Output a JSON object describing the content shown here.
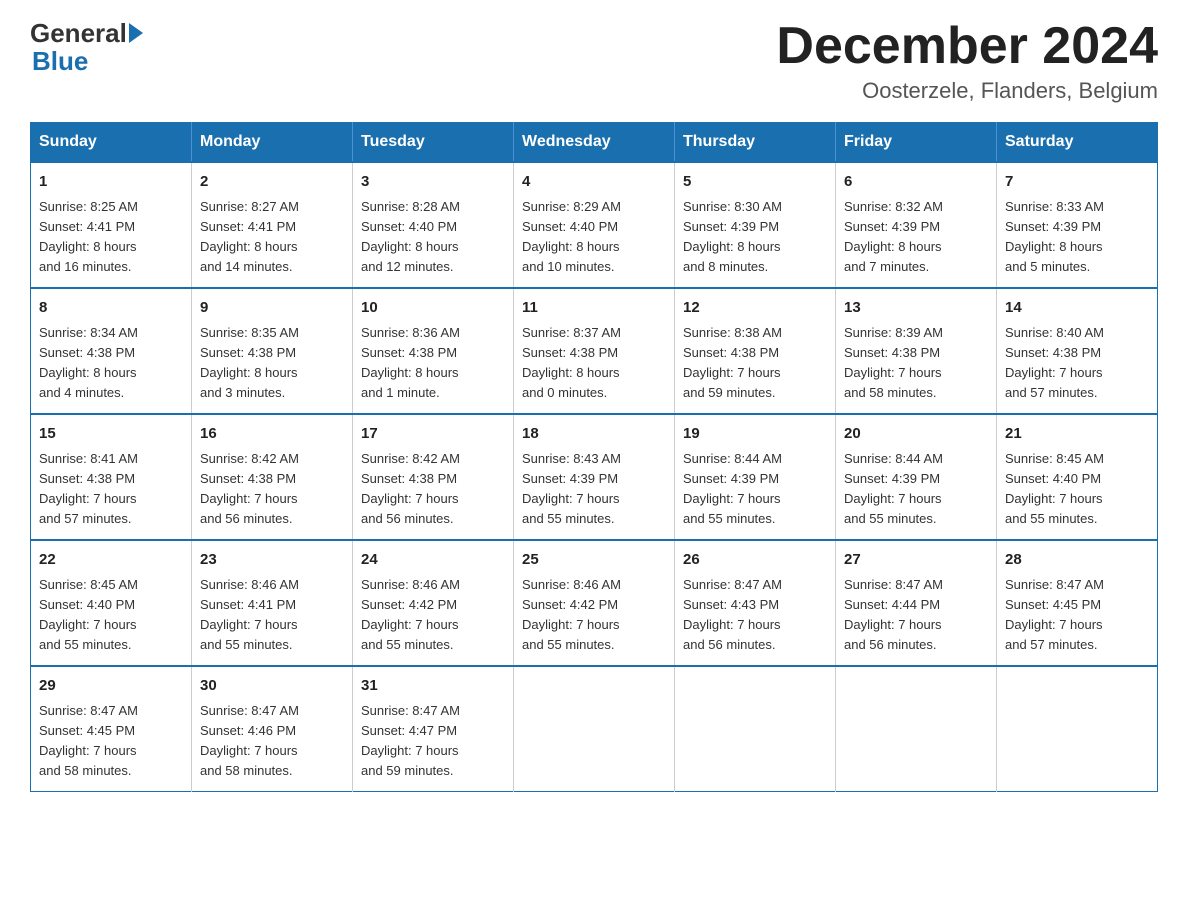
{
  "logo": {
    "general": "General",
    "blue": "Blue"
  },
  "title": "December 2024",
  "location": "Oosterzele, Flanders, Belgium",
  "days_of_week": [
    "Sunday",
    "Monday",
    "Tuesday",
    "Wednesday",
    "Thursday",
    "Friday",
    "Saturday"
  ],
  "weeks": [
    [
      {
        "day": "1",
        "info": "Sunrise: 8:25 AM\nSunset: 4:41 PM\nDaylight: 8 hours\nand 16 minutes."
      },
      {
        "day": "2",
        "info": "Sunrise: 8:27 AM\nSunset: 4:41 PM\nDaylight: 8 hours\nand 14 minutes."
      },
      {
        "day": "3",
        "info": "Sunrise: 8:28 AM\nSunset: 4:40 PM\nDaylight: 8 hours\nand 12 minutes."
      },
      {
        "day": "4",
        "info": "Sunrise: 8:29 AM\nSunset: 4:40 PM\nDaylight: 8 hours\nand 10 minutes."
      },
      {
        "day": "5",
        "info": "Sunrise: 8:30 AM\nSunset: 4:39 PM\nDaylight: 8 hours\nand 8 minutes."
      },
      {
        "day": "6",
        "info": "Sunrise: 8:32 AM\nSunset: 4:39 PM\nDaylight: 8 hours\nand 7 minutes."
      },
      {
        "day": "7",
        "info": "Sunrise: 8:33 AM\nSunset: 4:39 PM\nDaylight: 8 hours\nand 5 minutes."
      }
    ],
    [
      {
        "day": "8",
        "info": "Sunrise: 8:34 AM\nSunset: 4:38 PM\nDaylight: 8 hours\nand 4 minutes."
      },
      {
        "day": "9",
        "info": "Sunrise: 8:35 AM\nSunset: 4:38 PM\nDaylight: 8 hours\nand 3 minutes."
      },
      {
        "day": "10",
        "info": "Sunrise: 8:36 AM\nSunset: 4:38 PM\nDaylight: 8 hours\nand 1 minute."
      },
      {
        "day": "11",
        "info": "Sunrise: 8:37 AM\nSunset: 4:38 PM\nDaylight: 8 hours\nand 0 minutes."
      },
      {
        "day": "12",
        "info": "Sunrise: 8:38 AM\nSunset: 4:38 PM\nDaylight: 7 hours\nand 59 minutes."
      },
      {
        "day": "13",
        "info": "Sunrise: 8:39 AM\nSunset: 4:38 PM\nDaylight: 7 hours\nand 58 minutes."
      },
      {
        "day": "14",
        "info": "Sunrise: 8:40 AM\nSunset: 4:38 PM\nDaylight: 7 hours\nand 57 minutes."
      }
    ],
    [
      {
        "day": "15",
        "info": "Sunrise: 8:41 AM\nSunset: 4:38 PM\nDaylight: 7 hours\nand 57 minutes."
      },
      {
        "day": "16",
        "info": "Sunrise: 8:42 AM\nSunset: 4:38 PM\nDaylight: 7 hours\nand 56 minutes."
      },
      {
        "day": "17",
        "info": "Sunrise: 8:42 AM\nSunset: 4:38 PM\nDaylight: 7 hours\nand 56 minutes."
      },
      {
        "day": "18",
        "info": "Sunrise: 8:43 AM\nSunset: 4:39 PM\nDaylight: 7 hours\nand 55 minutes."
      },
      {
        "day": "19",
        "info": "Sunrise: 8:44 AM\nSunset: 4:39 PM\nDaylight: 7 hours\nand 55 minutes."
      },
      {
        "day": "20",
        "info": "Sunrise: 8:44 AM\nSunset: 4:39 PM\nDaylight: 7 hours\nand 55 minutes."
      },
      {
        "day": "21",
        "info": "Sunrise: 8:45 AM\nSunset: 4:40 PM\nDaylight: 7 hours\nand 55 minutes."
      }
    ],
    [
      {
        "day": "22",
        "info": "Sunrise: 8:45 AM\nSunset: 4:40 PM\nDaylight: 7 hours\nand 55 minutes."
      },
      {
        "day": "23",
        "info": "Sunrise: 8:46 AM\nSunset: 4:41 PM\nDaylight: 7 hours\nand 55 minutes."
      },
      {
        "day": "24",
        "info": "Sunrise: 8:46 AM\nSunset: 4:42 PM\nDaylight: 7 hours\nand 55 minutes."
      },
      {
        "day": "25",
        "info": "Sunrise: 8:46 AM\nSunset: 4:42 PM\nDaylight: 7 hours\nand 55 minutes."
      },
      {
        "day": "26",
        "info": "Sunrise: 8:47 AM\nSunset: 4:43 PM\nDaylight: 7 hours\nand 56 minutes."
      },
      {
        "day": "27",
        "info": "Sunrise: 8:47 AM\nSunset: 4:44 PM\nDaylight: 7 hours\nand 56 minutes."
      },
      {
        "day": "28",
        "info": "Sunrise: 8:47 AM\nSunset: 4:45 PM\nDaylight: 7 hours\nand 57 minutes."
      }
    ],
    [
      {
        "day": "29",
        "info": "Sunrise: 8:47 AM\nSunset: 4:45 PM\nDaylight: 7 hours\nand 58 minutes."
      },
      {
        "day": "30",
        "info": "Sunrise: 8:47 AM\nSunset: 4:46 PM\nDaylight: 7 hours\nand 58 minutes."
      },
      {
        "day": "31",
        "info": "Sunrise: 8:47 AM\nSunset: 4:47 PM\nDaylight: 7 hours\nand 59 minutes."
      },
      null,
      null,
      null,
      null
    ]
  ]
}
